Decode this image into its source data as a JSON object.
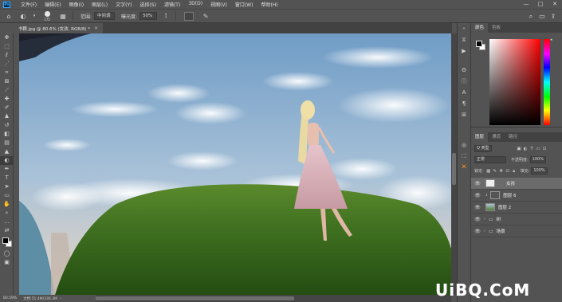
{
  "app": {
    "logo": "Ps"
  },
  "menu": [
    "文件(F)",
    "编辑(E)",
    "图像(I)",
    "图层(L)",
    "文字(Y)",
    "选择(S)",
    "滤镜(T)",
    "3D(D)",
    "视图(V)",
    "窗口(W)",
    "帮助(H)"
  ],
  "window_controls": {
    "minimize": "—",
    "maximize": "□",
    "close": "✕"
  },
  "options": {
    "brush_size": "175",
    "range_label": "范围:",
    "range_value": "中间调",
    "exposure_label": "曝光度:",
    "exposure_value": "50%"
  },
  "document": {
    "tab_title": "书籍.jpg @ 80.6% (女孩, RGB/8) *",
    "close": "×"
  },
  "status": {
    "zoom": "80.59%",
    "doc_info": "文档:51.4M/330.3M"
  },
  "color_panel": {
    "tabs": [
      "颜色",
      "色板"
    ],
    "foreground": "#000000",
    "background": "#ffffff"
  },
  "layers_panel": {
    "tabs": [
      "图层",
      "通道",
      "路径"
    ],
    "filter_label": "Q 类型",
    "blend_mode": "正常",
    "opacity_label": "不透明度:",
    "opacity_value": "100%",
    "lock_label": "锁定:",
    "fill_label": "填充:",
    "fill_value": "100%",
    "layers": [
      {
        "name": "女孩",
        "visible": true,
        "selected": true
      },
      {
        "name": "图层 6",
        "visible": true,
        "selected": false
      },
      {
        "name": "图层 2",
        "visible": true,
        "selected": false
      },
      {
        "name": "树",
        "visible": true,
        "selected": false,
        "group": true
      },
      {
        "name": "场景",
        "visible": true,
        "selected": false,
        "group": true
      }
    ]
  },
  "watermark": "UiBQ.CoM"
}
